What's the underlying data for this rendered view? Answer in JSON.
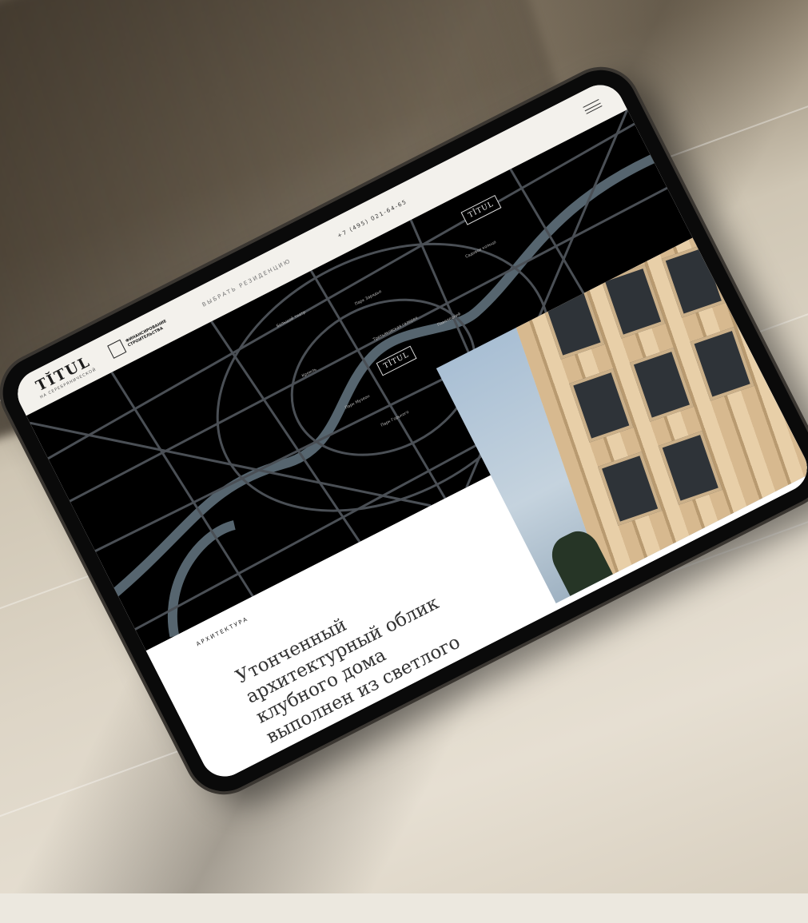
{
  "site": {
    "logo_text": "TĬTUL",
    "logo_sub": "НА СЕРЕБРЯНИЧЕСКОЙ",
    "partner_text": "ФИНАНСИРОВАНИЕ СТРОИТЕЛЬСТВА",
    "nav_link": "ВЫБРАТЬ РЕЗИДЕНЦИЮ",
    "phone": "+7 (495) 021-64-65"
  },
  "map": {
    "labels": [
      "Большой театр",
      "Парк Зарядье",
      "Третьяковская галерея",
      "Кремль",
      "Парк Музеон",
      "Парк Горького",
      "Павелецкий",
      "Садовое кольцо"
    ],
    "logo_text": "TĬTUL"
  },
  "architecture": {
    "section_label": "АРХИТЕКТУРА",
    "headline": "Утонченный архитектурный облик клубного дома выполнен из светлого натурального камня"
  },
  "colors": {
    "map_bg": "#000000",
    "road": "#4a4f55",
    "river": "#56656f",
    "header_bg": "#f3f1ec"
  }
}
